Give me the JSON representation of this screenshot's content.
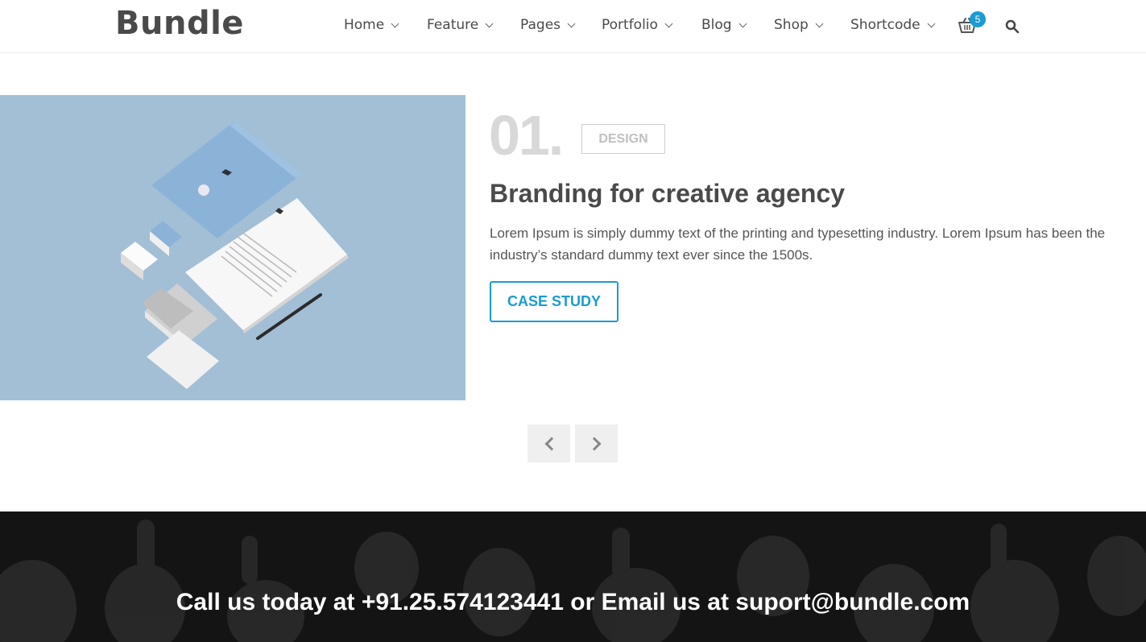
{
  "header": {
    "logo": "Bundle",
    "nav": [
      {
        "label": "Home"
      },
      {
        "label": "Feature"
      },
      {
        "label": "Pages"
      },
      {
        "label": "Portfolio"
      },
      {
        "label": "Blog"
      },
      {
        "label": "Shop"
      },
      {
        "label": "Shortcode"
      }
    ],
    "cart_count": "5",
    "icons": {
      "cart": "cart-icon",
      "search": "search-icon"
    }
  },
  "slide": {
    "number": "01.",
    "tag": "DESIGN",
    "title": "Branding for creative agency",
    "description": "Lorem Ipsum is simply dummy text of the printing and typesetting industry. Lorem Ipsum has been the industry’s standard dummy text ever since the 1500s.",
    "button": "CASE STUDY"
  },
  "cta": {
    "text": "Call us today at +91.25.574123441 or Email us at suport@bundle.com"
  },
  "colors": {
    "accent": "#1a9bd1",
    "image_bg": "#a3bfd6",
    "cta_bg": "#141414"
  }
}
